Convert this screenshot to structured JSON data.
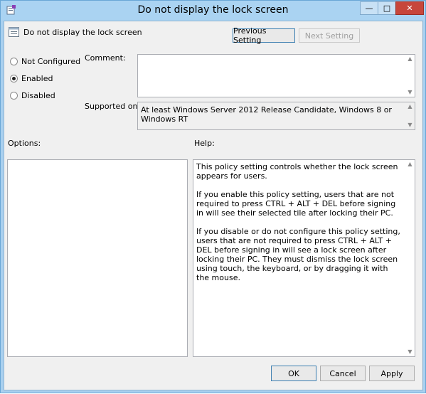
{
  "window": {
    "title": "Do not display the lock screen",
    "controls": {
      "minimize": "—",
      "maximize": "□",
      "close": "✕"
    }
  },
  "header": {
    "policy_name": "Do not display the lock screen",
    "previous_label": "Previous Setting",
    "next_label": "Next Setting"
  },
  "state": {
    "options": [
      {
        "label": "Not Configured",
        "selected": false
      },
      {
        "label": "Enabled",
        "selected": true
      },
      {
        "label": "Disabled",
        "selected": false
      }
    ]
  },
  "comment": {
    "label": "Comment:",
    "value": ""
  },
  "supported": {
    "label": "Supported on:",
    "value": "At least Windows Server 2012 Release Candidate, Windows 8 or Windows RT"
  },
  "options_label": "Options:",
  "help": {
    "label": "Help:",
    "paragraphs": [
      "This policy setting controls whether the lock screen appears for users.",
      "If you enable this policy setting, users that are not required to press CTRL + ALT + DEL before signing in will see their selected tile after  locking their PC.",
      "If you disable or do not configure this policy setting, users that are not required to press CTRL + ALT + DEL before signing in will see a lock screen after locking their PC. They must dismiss the lock screen using touch, the keyboard, or by dragging it with the mouse."
    ]
  },
  "footer": {
    "ok": "OK",
    "cancel": "Cancel",
    "apply": "Apply"
  },
  "icons": {
    "app": "policy-app-icon",
    "policy": "policy-setting-icon"
  },
  "colors": {
    "titlebar": "#aad3f2",
    "close": "#c7463b",
    "dialog": "#f0f0f0"
  }
}
